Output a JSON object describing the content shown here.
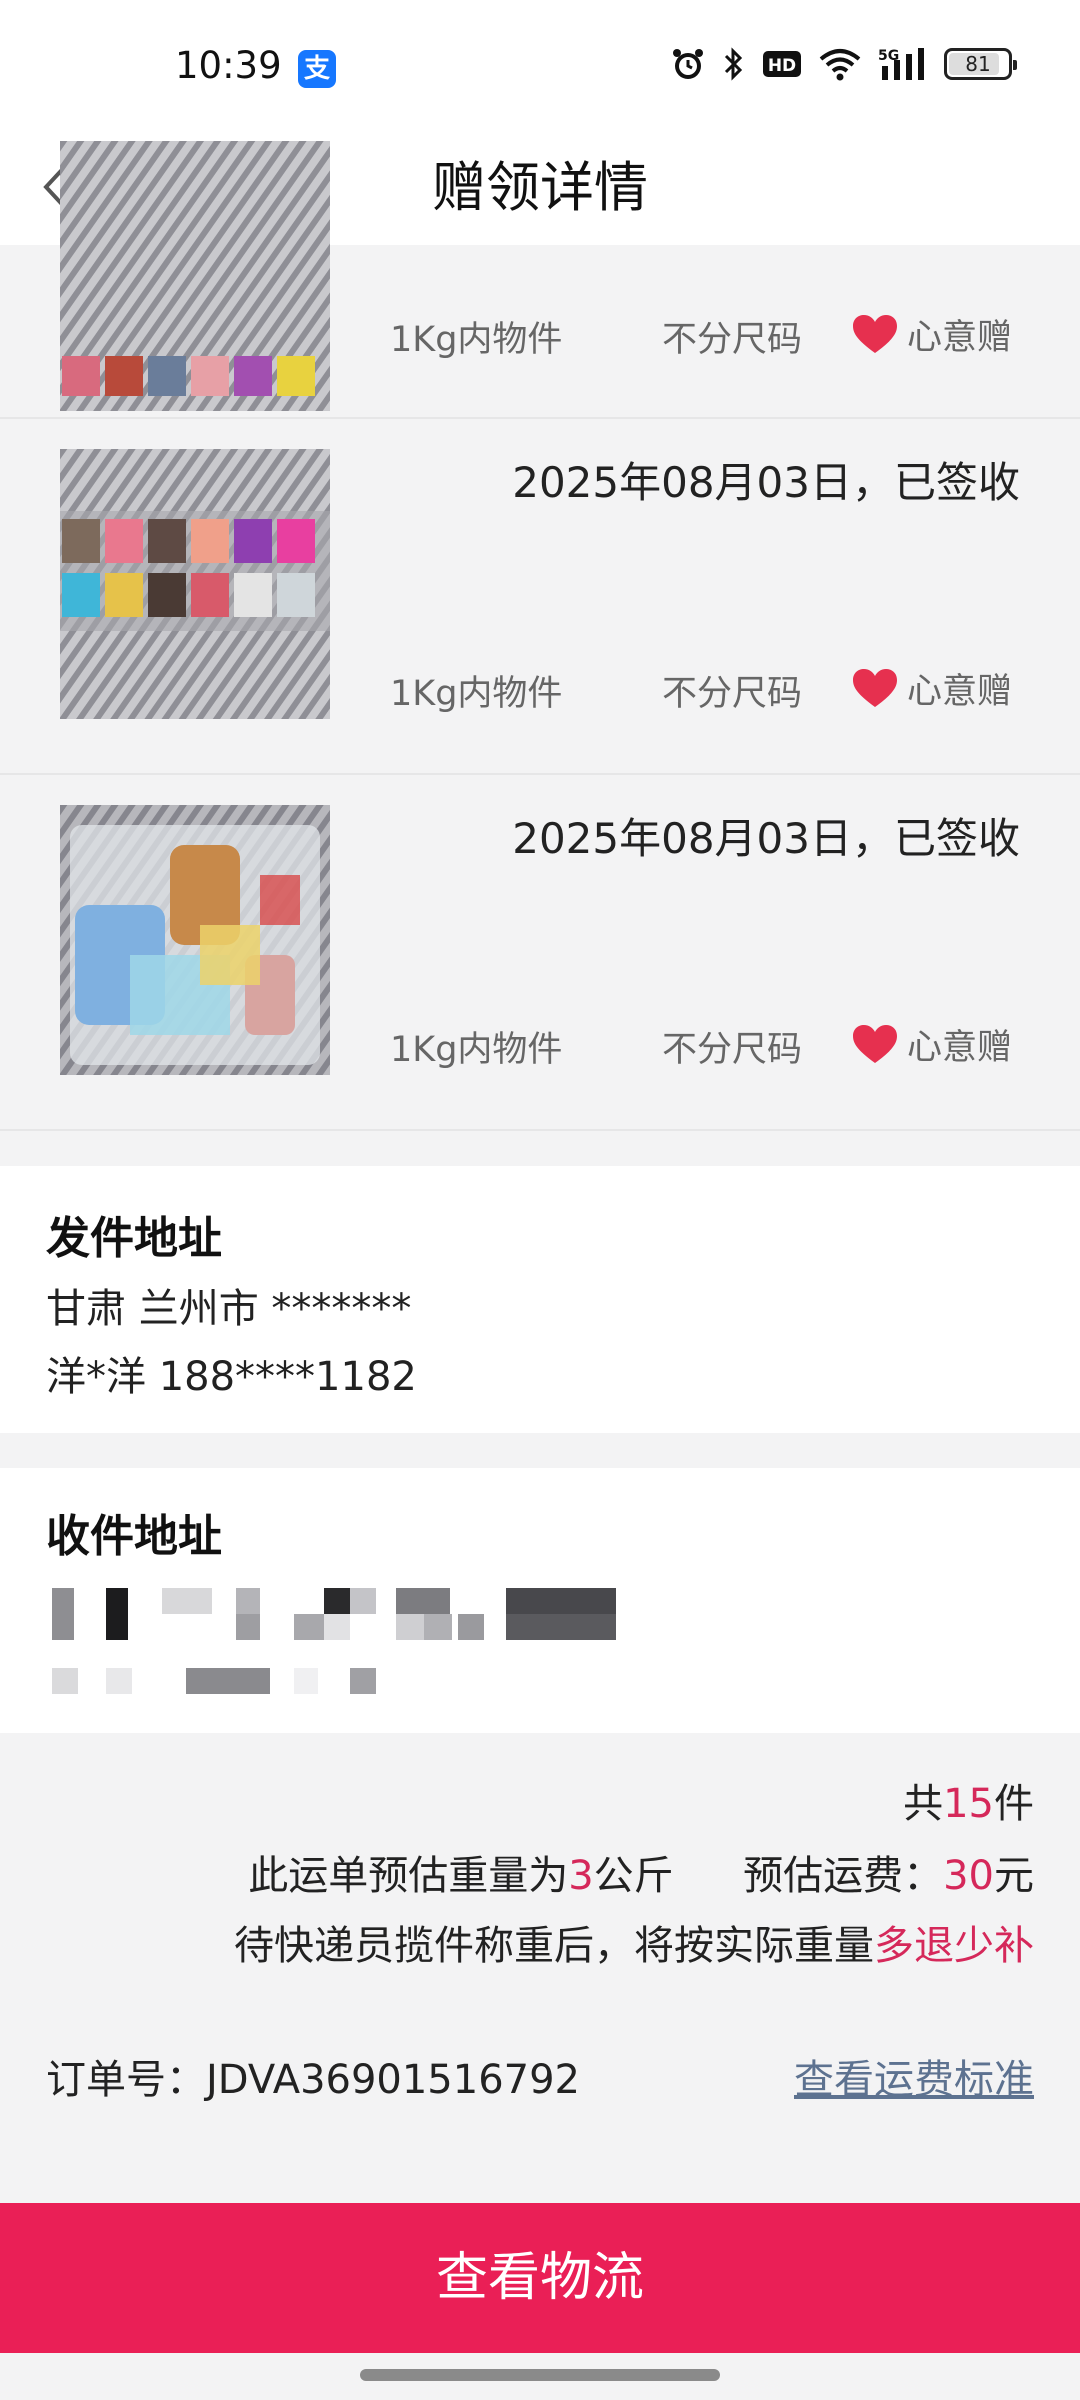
{
  "status_bar": {
    "time": "10:39",
    "app_badge": "支",
    "battery": "81",
    "network": "5G",
    "hd": "HD",
    "icons": [
      "alarm-icon",
      "bluetooth-icon",
      "hd-icon",
      "wifi-icon",
      "signal-5g-icon",
      "battery-icon"
    ]
  },
  "nav": {
    "title": "赠领详情"
  },
  "items": [
    {
      "date": "",
      "weight": "1Kg内物件",
      "size": "不分尺码",
      "gift_label": "心意赠"
    },
    {
      "date": "2025年08月03日，已签收",
      "weight": "1Kg内物件",
      "size": "不分尺码",
      "gift_label": "心意赠"
    },
    {
      "date": "2025年08月03日，已签收",
      "weight": "1Kg内物件",
      "size": "不分尺码",
      "gift_label": "心意赠"
    }
  ],
  "sender": {
    "title": "发件地址",
    "address": "甘肃 兰州市 *******",
    "contact": "洋*洋 188****1182"
  },
  "receiver": {
    "title": "收件地址"
  },
  "summary": {
    "count_prefix": "共",
    "count": "15",
    "count_suffix": "件",
    "weight_prefix": "此运单预估重量为",
    "weight": "3",
    "weight_suffix": "公斤",
    "fee_prefix": "预估运费：",
    "fee": "30",
    "fee_suffix": "元",
    "note_prefix": "待快递员揽件称重后，将按实际重量",
    "note_accent": "多退少补",
    "order_label": "订单号：",
    "order_number": "JDVA36901516792",
    "fee_link": "查看运费标准"
  },
  "bottom_button": {
    "label": "查看物流"
  },
  "colors": {
    "accent": "#d5285a",
    "button": "#ea1f56",
    "link": "#5d7290",
    "heart": "#e6304f"
  }
}
